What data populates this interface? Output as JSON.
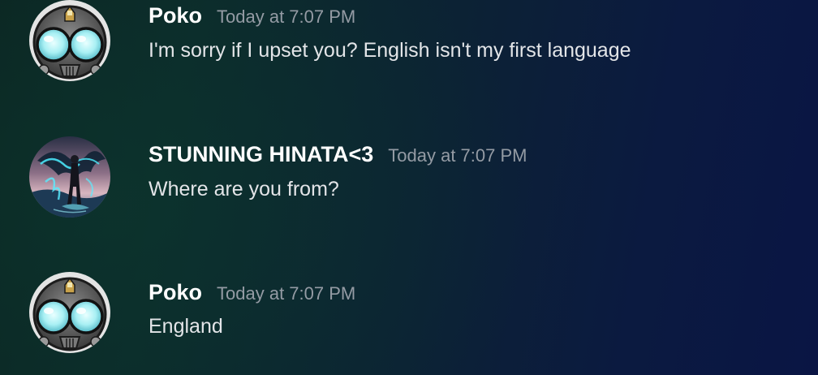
{
  "messages": [
    {
      "username": "Poko",
      "timestamp": "Today at 7:07 PM",
      "text": "I'm sorry if I upset you? English isn't my first language",
      "avatar_icon": "robot-mask-avatar-icon"
    },
    {
      "username": "STUNNING HINATA<3",
      "timestamp": "Today at 7:07 PM",
      "text": "Where are you from?",
      "avatar_icon": "dragon-warrior-avatar-icon"
    },
    {
      "username": "Poko",
      "timestamp": "Today at 7:07 PM",
      "text": "England",
      "avatar_icon": "robot-mask-avatar-icon"
    }
  ],
  "colors": {
    "username": "#ffffff",
    "timestamp": "#949ba4",
    "message_text": "#e3e5e8",
    "background_left": "#0b2421",
    "background_right": "#0a1544"
  }
}
